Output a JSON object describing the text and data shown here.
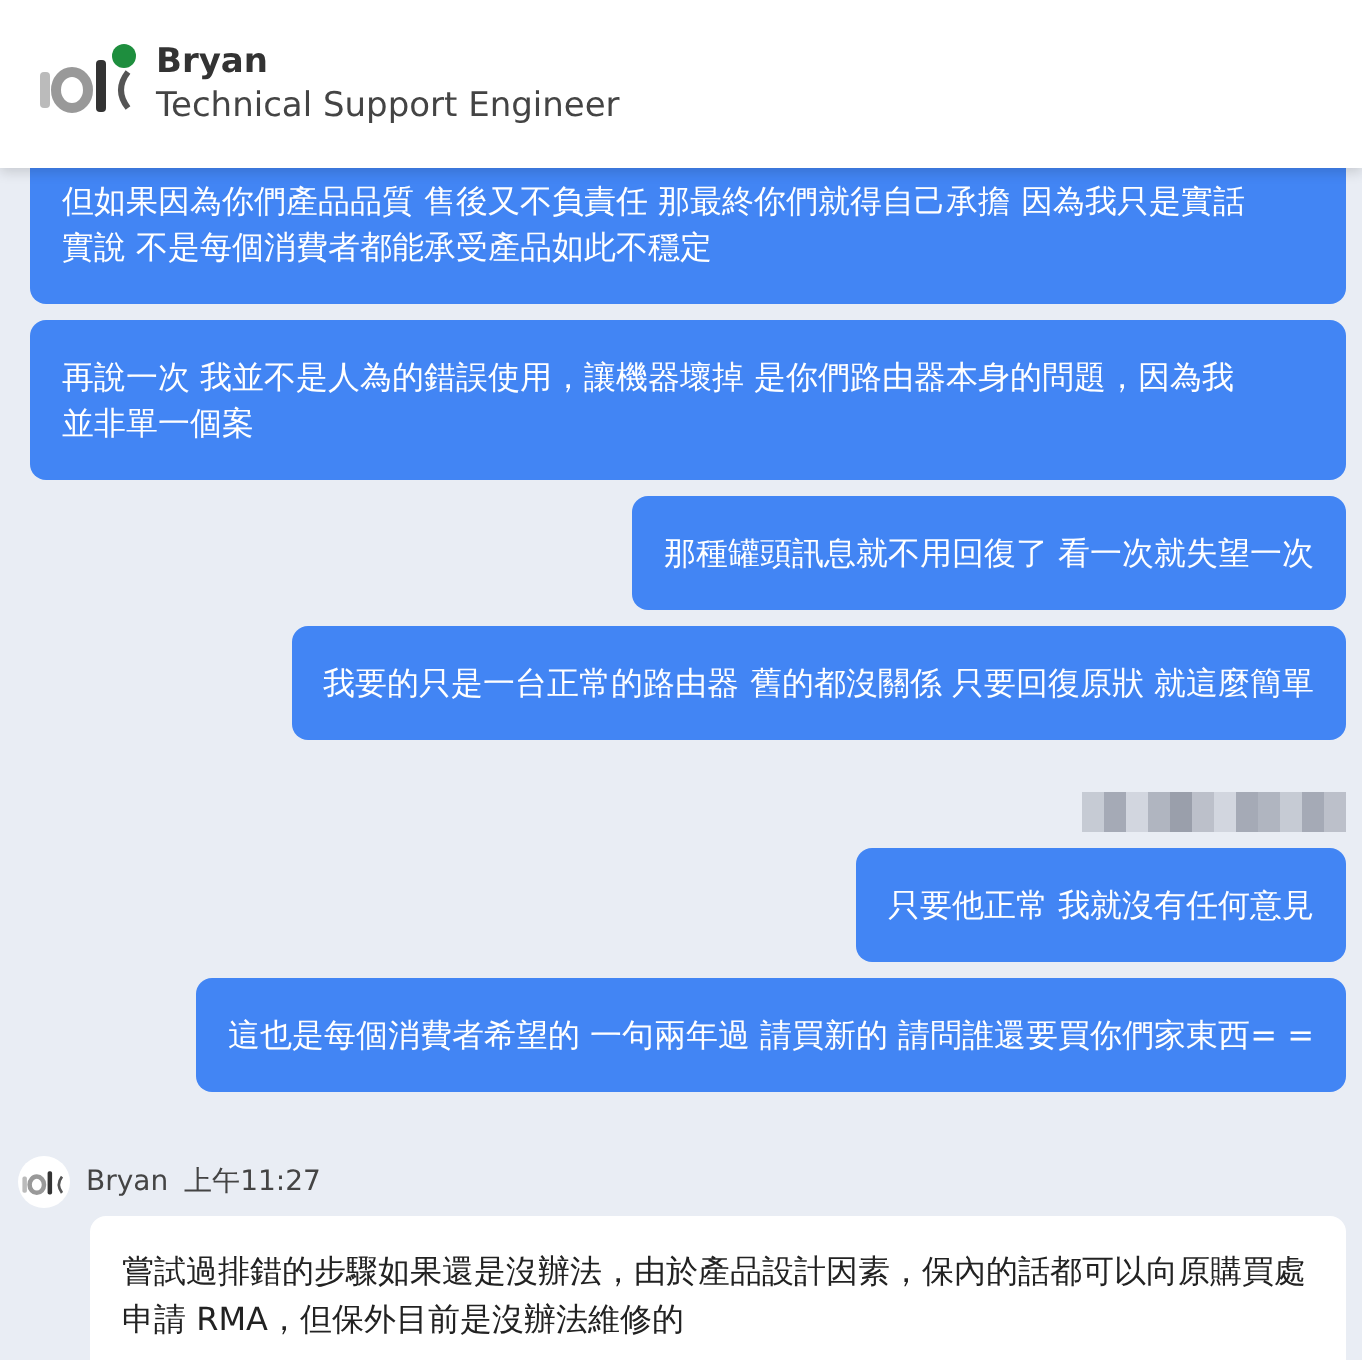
{
  "header": {
    "name": "Bryan",
    "title": "Technical Support Engineer",
    "online": true
  },
  "messages": [
    {
      "kind": "outgoing",
      "text": "但如果因為你們產品品質 售後又不負責任 那最終你們就得自己承擔 因為我只是實話實說 不是每個消費者都能承受產品如此不穩定"
    },
    {
      "kind": "outgoing",
      "text": "再說一次 我並不是人為的錯誤使用，讓機器壞掉 是你們路由器本身的問題，因為我並非單一個案"
    },
    {
      "kind": "outgoing",
      "text": "那種罐頭訊息就不用回復了 看一次就失望一次"
    },
    {
      "kind": "outgoing",
      "text": "我要的只是一台正常的路由器 舊的都沒關係 只要回復原狀 就這麼簡單"
    },
    {
      "kind": "blurred"
    },
    {
      "kind": "outgoing",
      "text": "只要他正常 我就沒有任何意見"
    },
    {
      "kind": "outgoing",
      "text": "這也是每個消費者希望的 一句兩年過 請買新的 請問誰還要買你們家東西= ="
    },
    {
      "kind": "incoming",
      "sender": "Bryan",
      "time": "上午11:27",
      "text": "嘗試過排錯的步驟如果還是沒辦法，由於產品設計因素，保內的話都可以向原購買處申請 RMA，但保外目前是沒辦法維修的"
    }
  ]
}
